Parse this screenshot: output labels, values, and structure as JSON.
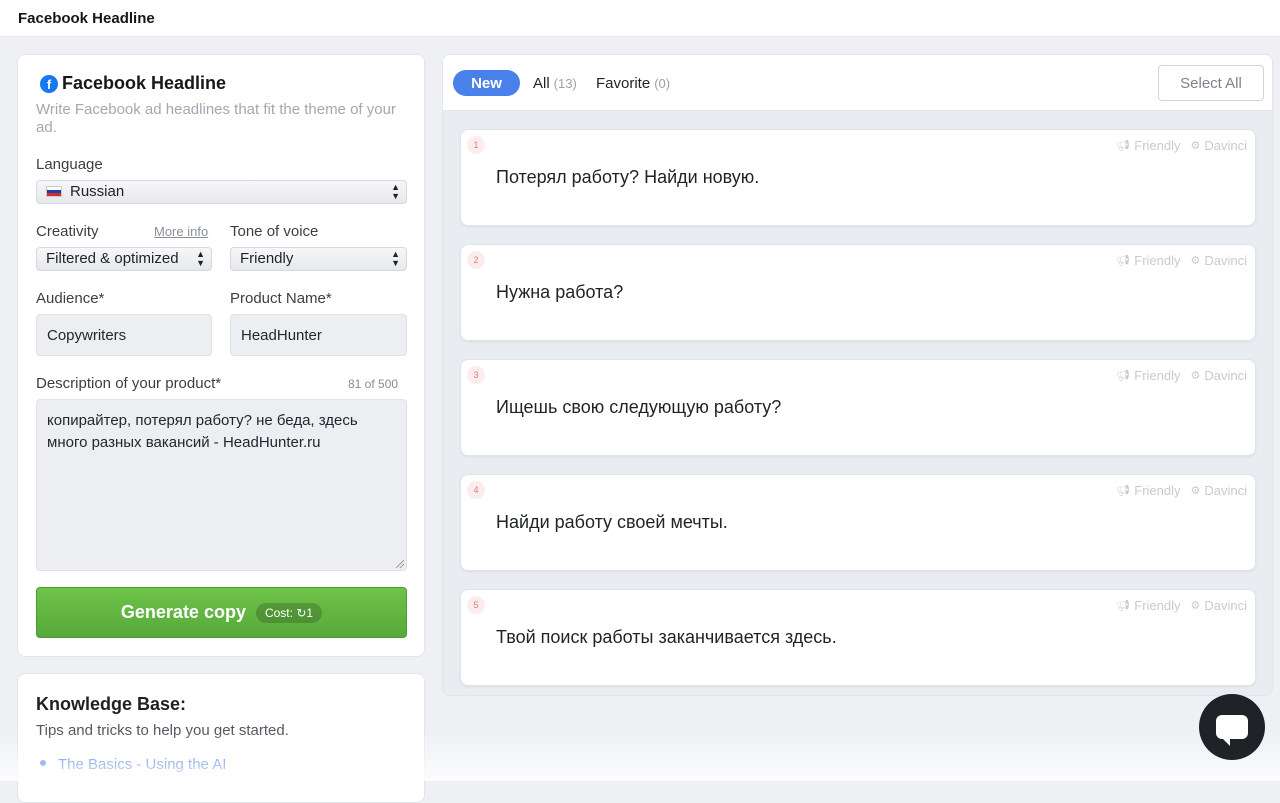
{
  "header": {
    "title": "Facebook Headline"
  },
  "form": {
    "title": "Facebook Headline",
    "description": "Write Facebook ad headlines that fit the theme of your ad.",
    "language_label": "Language",
    "language_value": "Russian",
    "creativity_label": "Creativity",
    "more_info": "More info",
    "creativity_value": "Filtered & optimized",
    "tone_label": "Tone of voice",
    "tone_value": "Friendly",
    "audience_label": "Audience*",
    "audience_value": "Copywriters",
    "product_label": "Product Name*",
    "product_value": "HeadHunter",
    "description_label": "Description of your product*",
    "description_counter": "81 of 500",
    "description_value": "копирайтер, потерял работу? не беда, здесь много разных вакансий - HeadHunter.ru",
    "generate_label": "Generate copy",
    "cost_label": "Cost:",
    "cost_value": "1"
  },
  "knowledge_base": {
    "title": "Knowledge Base:",
    "subtitle": "Tips and tricks to help you get started.",
    "links": [
      "The Basics - Using the AI"
    ]
  },
  "results": {
    "tabs": [
      {
        "label": "New"
      },
      {
        "label": "All",
        "count": "(13)"
      },
      {
        "label": "Favorite",
        "count": "(0)"
      }
    ],
    "select_all": "Select All",
    "items": [
      {
        "num": "1",
        "tone": "Friendly",
        "engine": "Davinci",
        "text": "Потерял работу? Найди новую."
      },
      {
        "num": "2",
        "tone": "Friendly",
        "engine": "Davinci",
        "text": "Нужна работа?"
      },
      {
        "num": "3",
        "tone": "Friendly",
        "engine": "Davinci",
        "text": "Ищешь свою следующую работу?"
      },
      {
        "num": "4",
        "tone": "Friendly",
        "engine": "Davinci",
        "text": "Найди работу своей мечты."
      },
      {
        "num": "5",
        "tone": "Friendly",
        "engine": "Davinci",
        "text": "Твой поиск работы заканчивается здесь."
      }
    ]
  },
  "colors": {
    "accent": "#4a80ea",
    "generate": "#5fb540",
    "facebook": "#1877f2"
  },
  "icons": {
    "facebook": "facebook-icon",
    "tone": "megaphone-icon",
    "engine": "gear-icon",
    "chat": "chat-icon",
    "refresh": "refresh-icon"
  }
}
